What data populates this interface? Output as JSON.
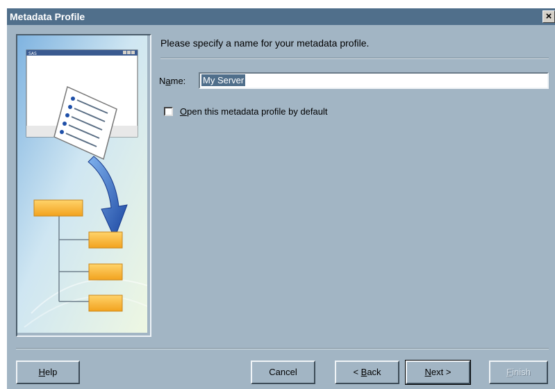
{
  "window": {
    "title": "Metadata Profile",
    "close_glyph": "×"
  },
  "illustration": {
    "mini_window_title": "SAS"
  },
  "main": {
    "prompt": "Please specify a name for your metadata profile.",
    "name_label_pre": "N",
    "name_label_mnemonic": "a",
    "name_label_post": "me:",
    "name_value": "My Server",
    "checkbox": {
      "mnemonic": "O",
      "label_rest": "pen this metadata profile by default",
      "checked": false
    }
  },
  "buttons": {
    "help": {
      "mnemonic": "H",
      "rest": "elp"
    },
    "cancel": {
      "label": "Cancel"
    },
    "back": {
      "pre": "< ",
      "mnemonic": "B",
      "rest": "ack"
    },
    "next": {
      "mnemonic": "N",
      "rest": "ext >"
    },
    "finish": {
      "mnemonic": "F",
      "rest": "inish",
      "enabled": false
    }
  },
  "colors": {
    "dialog_bg": "#a2b5c4",
    "titlebar": "#506f8b",
    "selection": "#506f8b",
    "folder_orange": "#f7b12f",
    "arrow_blue": "#1e4fa8"
  }
}
